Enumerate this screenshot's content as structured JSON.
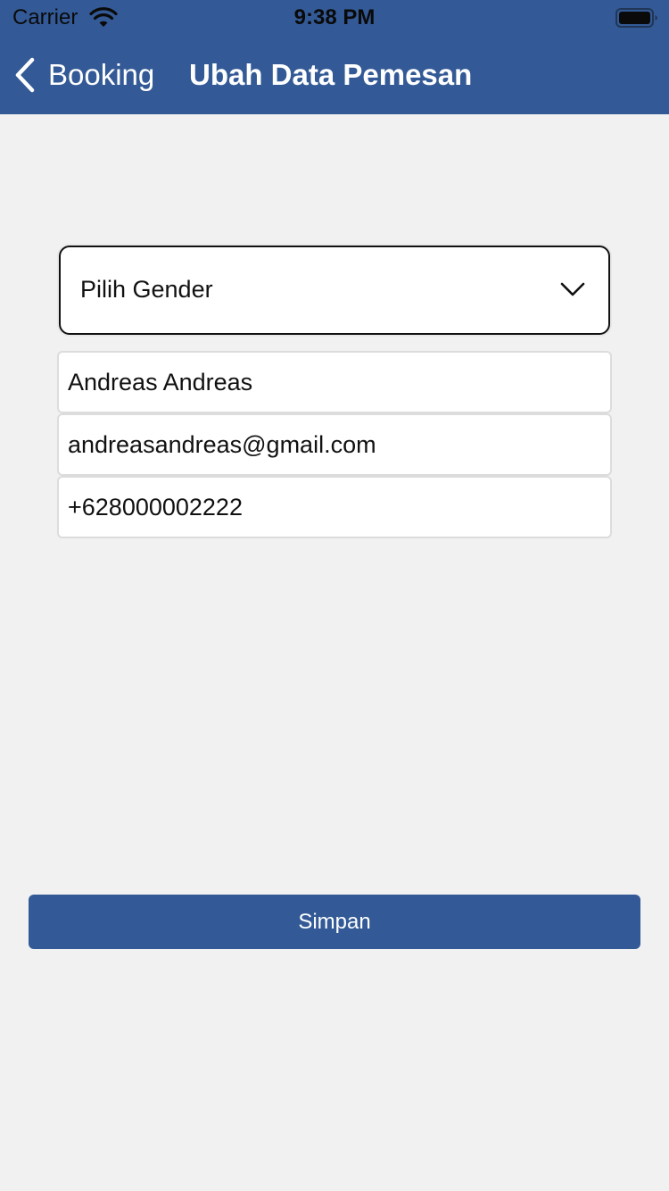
{
  "status_bar": {
    "carrier": "Carrier",
    "time": "9:38 PM",
    "icons": [
      "wifi-icon",
      "battery-icon"
    ]
  },
  "nav": {
    "back_label": "Booking",
    "back_icon": "chevron-left-icon",
    "title": "Ubah Data Pemesan"
  },
  "form": {
    "gender": {
      "label": "Pilih Gender",
      "icon": "chevron-down-icon"
    },
    "name": {
      "value": "Andreas Andreas"
    },
    "email": {
      "value": "andreasandreas@gmail.com"
    },
    "phone": {
      "value": "+628000002222"
    }
  },
  "actions": {
    "save_label": "Simpan"
  },
  "colors": {
    "brand": "#335a96",
    "background": "#f1f1f1",
    "field_border": "#dcdcdc"
  }
}
